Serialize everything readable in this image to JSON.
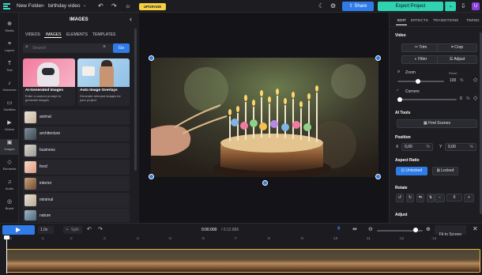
{
  "topbar": {
    "folder": "New Folder",
    "sep": "›",
    "project": "birthday video",
    "upgrade": "UPGRADE",
    "share": "Share",
    "export": "Export Project",
    "avatar": "U"
  },
  "leftnav": [
    {
      "label": "Media",
      "icon": "media-icon"
    },
    {
      "label": "Layers",
      "icon": "layers-icon"
    },
    {
      "label": "Text",
      "icon": "text-icon"
    },
    {
      "label": "Voiceover",
      "icon": "microphone-icon"
    },
    {
      "label": "Subtitles",
      "icon": "subtitles-icon"
    },
    {
      "label": "Videos",
      "icon": "video-icon"
    },
    {
      "label": "Images",
      "icon": "image-icon"
    },
    {
      "label": "Elements",
      "icon": "elements-icon"
    },
    {
      "label": "Audio",
      "icon": "music-icon"
    },
    {
      "label": "Brand",
      "icon": "brand-icon"
    }
  ],
  "panel": {
    "title": "IMAGES",
    "tabs": [
      "VIDEOS",
      "IMAGES",
      "ELEMENTS",
      "TEMPLATES"
    ],
    "active_tab": "IMAGES",
    "search_placeholder": "Search",
    "go": "Go",
    "cards": [
      {
        "title": "AI-Generated Images",
        "desc": "Enter a custom prompt to generate images"
      },
      {
        "title": "Auto Image Overlays",
        "desc": "Generate relevant images for your project"
      }
    ],
    "categories": [
      "animal",
      "architecture",
      "business",
      "food",
      "interior",
      "minimal",
      "nature"
    ]
  },
  "right": {
    "tabs": [
      "EDIT",
      "EFFECTS",
      "TRANSITIONS",
      "TIMING"
    ],
    "active_tab": "EDIT",
    "video_label": "Video",
    "trim": "Trim",
    "crop": "Crop",
    "filter": "Filter",
    "adjust": "Adjust",
    "zoom_label": "Zoom",
    "zoom_reset": "Reset",
    "zoom_value": "100",
    "zoom_unit": "%",
    "corners_label": "Corners",
    "corners_value": "0",
    "corners_unit": "%",
    "ai_tools": "AI Tools",
    "find_scenes": "Find Scenes",
    "position_label": "Position",
    "x_label": "X",
    "x_value": "0,00",
    "y_label": "Y",
    "y_value": "0,00",
    "pos_unit": "%",
    "aspect_label": "Aspect Ratio",
    "unlocked": "Unlocked",
    "locked": "Locked",
    "rotate_label": "Rotate",
    "rotate_value": "0",
    "adjust_label": "Adjust"
  },
  "timeline": {
    "speed": "1.0x",
    "split": "Split",
    "time_current": "0:00.000",
    "time_total": "/ 0:12.886",
    "fit": "Fit to Screen",
    "ticks": [
      ":0",
      ":1",
      ":2",
      ":3",
      ":4",
      ":5",
      ":6",
      ":7",
      ":8",
      ":9",
      ":10",
      ":11",
      ":12",
      ":13"
    ]
  },
  "colors": {
    "accent": "#2f7be8",
    "export": "#2fd2b1",
    "upgrade": "#f5d142"
  }
}
